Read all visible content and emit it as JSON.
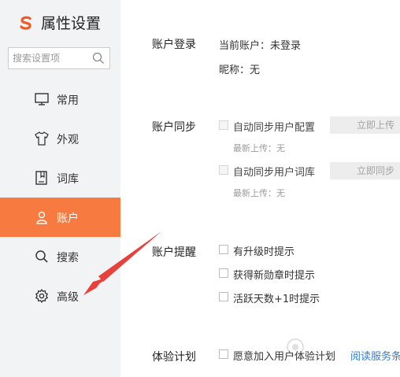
{
  "app": {
    "title": "属性设置",
    "brand_color": "#f77b40",
    "logo_icon": "sogou-s-logo-icon"
  },
  "search": {
    "placeholder": "搜索设置项",
    "icon": "search-icon"
  },
  "sidebar": {
    "items": [
      {
        "label": "常用",
        "icon": "monitor-icon",
        "active": false
      },
      {
        "label": "外观",
        "icon": "shirt-icon",
        "active": false
      },
      {
        "label": "词库",
        "icon": "book-icon",
        "active": false
      },
      {
        "label": "账户",
        "icon": "user-icon",
        "active": true
      },
      {
        "label": "搜索",
        "icon": "search-icon",
        "active": false
      },
      {
        "label": "高级",
        "icon": "gear-icon",
        "active": false
      }
    ]
  },
  "account_login": {
    "label": "账户登录",
    "current_account": "当前账户：未登录",
    "nickname": "昵称：无"
  },
  "account_sync": {
    "label": "账户同步",
    "options": [
      {
        "label": "自动同步用户配置",
        "button": "立即上传",
        "status": "最新上传：无",
        "checked": false,
        "enabled": false
      },
      {
        "label": "自动同步用户词库",
        "button": "立即同步",
        "status": "最新上传：无",
        "checked": false,
        "enabled": false
      }
    ]
  },
  "account_reminder": {
    "label": "账户提醒",
    "options": [
      {
        "label": "有升级时提示",
        "checked": false
      },
      {
        "label": "获得新勋章时提示",
        "checked": false
      },
      {
        "label": "活跃天数+1时提示",
        "checked": false
      }
    ]
  },
  "experience_plan": {
    "label": "体验计划",
    "option": "愿意加入用户体验计划",
    "link": "阅读服务条",
    "checked": false
  }
}
